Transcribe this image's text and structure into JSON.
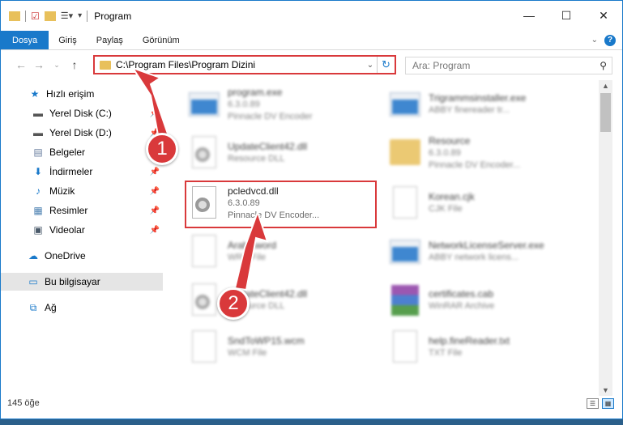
{
  "window": {
    "title": "Program",
    "controls": [
      "—",
      "☐",
      "✕"
    ]
  },
  "ribbon": {
    "tabs": [
      "Dosya",
      "Giriş",
      "Paylaş",
      "Görünüm"
    ]
  },
  "address": {
    "path": "C:\\Program Files\\Program Dizini",
    "search_placeholder": "Ara: Program"
  },
  "sidebar": {
    "items": [
      {
        "label": "Hızlı erişim",
        "icon": "star-icon",
        "pinned": false
      },
      {
        "label": "Yerel Disk (C:)",
        "icon": "drive-icon",
        "pinned": true
      },
      {
        "label": "Yerel Disk (D:)",
        "icon": "drive-icon",
        "pinned": true
      },
      {
        "label": "Belgeler",
        "icon": "documents-icon",
        "pinned": true
      },
      {
        "label": "İndirmeler",
        "icon": "download-icon",
        "pinned": true
      },
      {
        "label": "Müzik",
        "icon": "music-icon",
        "pinned": true
      },
      {
        "label": "Resimler",
        "icon": "pictures-icon",
        "pinned": true
      },
      {
        "label": "Videolar",
        "icon": "video-icon",
        "pinned": true
      },
      {
        "label": "OneDrive",
        "icon": "cloud-icon",
        "pinned": false
      },
      {
        "label": "Bu bilgisayar",
        "icon": "computer-icon",
        "pinned": false,
        "selected": true
      },
      {
        "label": "Ağ",
        "icon": "network-icon",
        "pinned": false
      }
    ]
  },
  "files": [
    {
      "name": "program.exe",
      "line1": "6.3.0.89",
      "line2": "Pinnacle DV Encoder",
      "type": "exe"
    },
    {
      "name": "Trigrammsinstaller.exe",
      "line1": "ABBY finereader tr...",
      "line2": "",
      "type": "exe"
    },
    {
      "name": "UpdateClient42.dll",
      "line1": "Resource DLL",
      "line2": "",
      "type": "dll"
    },
    {
      "name": "Resource",
      "line1": "6.3.0.89",
      "line2": "Pinnacle DV Encoder...",
      "type": "folder"
    },
    {
      "name": "pcledvcd.dll",
      "line1": "6.3.0.89",
      "line2": "Pinnacle DV Encoder...",
      "type": "dll"
    },
    {
      "name": "Korean.cjk",
      "line1": "CJK File",
      "line2": "",
      "type": "doc"
    },
    {
      "name": "Arabicword",
      "line1": "WRD File",
      "line2": "",
      "type": "doc"
    },
    {
      "name": "NetworkLicenseServer.exe",
      "line1": "ABBY network licens...",
      "line2": "",
      "type": "exe"
    },
    {
      "name": "UpdateClient42.dll",
      "line1": "Resource DLL",
      "line2": "",
      "type": "dll"
    },
    {
      "name": "certificates.cab",
      "line1": "WinRAR Archive",
      "line2": "",
      "type": "rar"
    },
    {
      "name": "SndToWP15.wcm",
      "line1": "WCM File",
      "line2": "",
      "type": "doc"
    },
    {
      "name": "help.fineReader.txt",
      "line1": "TXT File",
      "line2": "",
      "type": "doc"
    }
  ],
  "status": {
    "count": "145 öğe"
  },
  "callouts": [
    "1",
    "2"
  ]
}
